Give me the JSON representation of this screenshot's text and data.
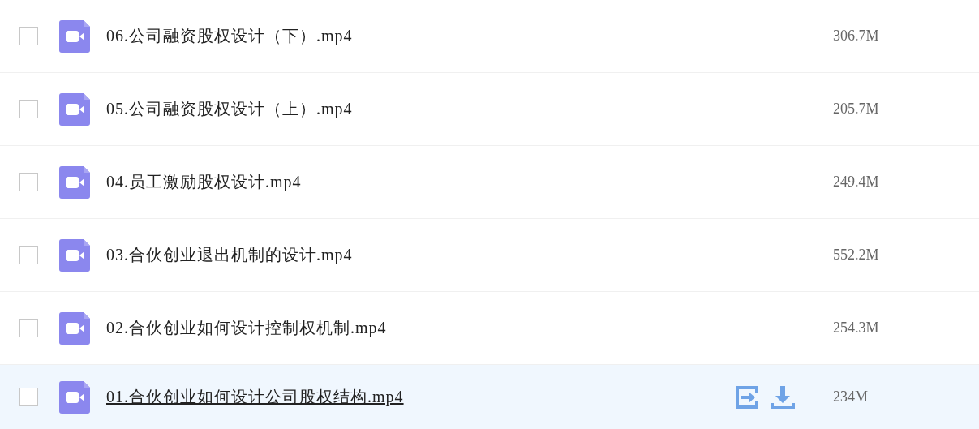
{
  "files": [
    {
      "name": "06.公司融资股权设计（下）.mp4",
      "size": "306.7M",
      "checked": false,
      "hovered": false
    },
    {
      "name": "05.公司融资股权设计（上）.mp4",
      "size": "205.7M",
      "checked": false,
      "hovered": false
    },
    {
      "name": "04.员工激励股权设计.mp4",
      "size": "249.4M",
      "checked": false,
      "hovered": false
    },
    {
      "name": "03.合伙创业退出机制的设计.mp4",
      "size": "552.2M",
      "checked": false,
      "hovered": false
    },
    {
      "name": "02.合伙创业如何设计控制权机制.mp4",
      "size": "254.3M",
      "checked": false,
      "hovered": false
    },
    {
      "name": "01.合伙创业如何设计公司股权结构.mp4",
      "size": "234M",
      "checked": false,
      "hovered": true
    }
  ]
}
